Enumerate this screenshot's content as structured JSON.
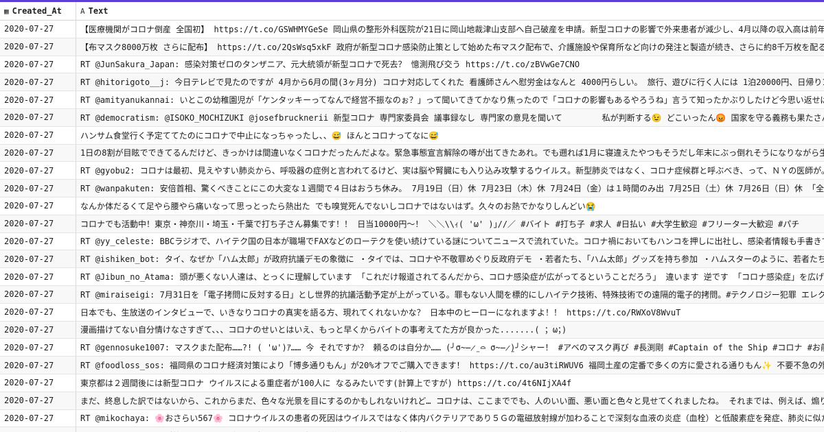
{
  "columns": {
    "date": {
      "icon": "▦",
      "label": "Created_At"
    },
    "text": {
      "icon": "A",
      "label": "Text"
    }
  },
  "rows": [
    {
      "date": "2020-07-27",
      "text": "【医療機関がコロナ倒産 全国初】 https://t.co/GSWHMYGeSe 岡山県の整形外科医院が21日に岡山地裁津山支部へ自己破産を申請。新型コロナの影響で外来患者が減少し、4月以降の収入高は前年同"
    },
    {
      "date": "2020-07-27",
      "text": "【布マスク8000万枚 さらに配布】 https://t.co/2QsWsq5xkF 政府が新型コロナ感染防止策として始めた布マスク配布で、介護施設や保育所など向けの発注と製造が続き、さらに約8千万枚を配る予"
    },
    {
      "date": "2020-07-27",
      "text": "RT @JunSakura_Japan: 感染対策ゼロのタンザニア、元大統領が新型コロナで死去？ 憶測飛び交う https://t.co/zBVwGe7CNO"
    },
    {
      "date": "2020-07-27",
      "text": "RT @hitorigoto__j: 今日テレビで見たのですが 4月から6月の間(3ヶ月分) コロナ対応してくれた 看護師さんへ慰労金はなんと 4000円らしい。 旅行、遊びに行く人には 1泊20000円、日帰り1万"
    },
    {
      "date": "2020-07-27",
      "text": "RT @amityanukannai: いとこの幼稚園児が「ケンタッキーってなんで経営不振なのぉ？」って聞いてきてかなり焦ったので「コロナの影響もあるやろうね」言うて知ったかぶりしたけど今思い返せば"
    },
    {
      "date": "2020-07-27",
      "text": "RT @democratism: @ISOKO_MOCHIZUKI @josefbrucknerii 新型コロナ 専門家委員会 議事録なし 専門家の意見を聞いて        私が判断する😉 どこいったん😡 国家を守る義務も果たさん奴は"
    },
    {
      "date": "2020-07-27",
      "text": "ハンサム食堂行く予定ててたのにコロナで中止になっちゃったし、、😅 ほんとコロナってなに😅"
    },
    {
      "date": "2020-07-27",
      "text": "1日の8割が目眩でできてるんだけど、きっかけは間違いなくコロナだったんだよな。緊急事態宣言解除の噂が出てきたあれ。でも遡れば1月に寝違えたやつもそうだし年末にぶっ倒れそうになりながら生"
    },
    {
      "date": "2020-07-27",
      "text": "RT @gyobu2: コロナは最初、見えやすい肺炎から、呼吸器の症例と言われてるけど、実は脳や腎臓にも入り込み攻撃するウイルス。新型肺炎ではなく、コロナ症候群と呼ぶべき、って、ＮＹの医師が。"
    },
    {
      "date": "2020-07-27",
      "text": "RT @wanpakuten: 安倍首相、驚くべきことにこの大変な１週間で４日はおうち休み。 7月19日（日）休 7月23日（木）休 7月24日（金）は１時間のみ出 7月25日（土）休 7月26日（日）休 「全力"
    },
    {
      "date": "2020-07-27",
      "text": "なんか体だるくて足やら腰やら痛いなって思っとったら熱出た でも嗅覚死んでないしコロナではないはず。久々のお熱でかなりしんどい😭"
    },
    {
      "date": "2020-07-27",
      "text": "コロナでも活動中！東京・神奈川・埼玉・千葉で打ち子さん募集です！！ 日当10000円～！ ＼＼\\\\ｨ( 'ω' )｣//／ #バイト #打ち子 #求人 #日払い #大学生歓迎 #フリーター大歓迎 #パチ"
    },
    {
      "date": "2020-07-27",
      "text": "RT @yy_celeste: BBCラジオで、ハイテク国の日本が職場でFAXなどのローテクを使い続けている謎についてニュースで流れていた。コロナ禍においてもハンコを押しに出社し、感染者情報も手書きで"
    },
    {
      "date": "2020-07-27",
      "text": "RT @ishiken_bot: タイ、なぜか「ハム太郎」が政府抗議デモの象徴に ・タイでは、コロナや不敬罪めぐり反政府デモ ・若者たち、「ハム太郎」グッズを持ち参加 ・ハムスターのように、若者たち"
    },
    {
      "date": "2020-07-27",
      "text": "RT @Jibun_no_Atama: 頭が悪くない人達は、とっくに理解しています 「これだけ報道されてるんだから、コロナ感染症が広がってるということだろう」 違います 逆です 「コロナ感染症」を広げた"
    },
    {
      "date": "2020-07-27",
      "text": "RT @miraiseigi: 7月31日を「電子拷問に反対する日」とし世界的抗議活動予定が上がっている。罪もない人間を標的にしハイテク技術、特殊技術での遠隔的電子的拷問。#テクノロジー犯罪 エレクト"
    },
    {
      "date": "2020-07-27",
      "text": "日本でも、生放送のインタビューで、いきなりコロナの真実を語る方、現れてくれないかな？ 日本中のヒーローになれますよ！！ https://t.co/RWXoV8WvuT"
    },
    {
      "date": "2020-07-27",
      "text": "漫画描けてない自分情けなさすぎて、、、コロナのせいとはいえ、もっと早くからバイトの事考えてた方が良かった.......( ；ω；)"
    },
    {
      "date": "2020-07-27",
      "text": "RT @gennosuke1007: マスクまた配布……?! ( 'ω')ｱ…… 今 それですか？ 頼るのは自分か…… (╯σ̴̶̷̤ ⌓ σ̴̶̷̤)╯シャー！ #アベのマスク再び #長渕剛 #Captain of the Ship #コロナ #お前が舵を取れ"
    },
    {
      "date": "2020-07-27",
      "text": "RT @foodloss_sos: 福岡県のコロナ経済対策により「博多通りもん」が20%オフでご購入できます！ https://t.co/au3tiRWUV6 福岡土産の定番で多くの方に愛される通りもん✨ 不要不急の外出"
    },
    {
      "date": "2020-07-27",
      "text": "東京都は２週間後には新型コロナ ウイルスによる重症者が100人に なるみたいです(計算上ですが) https://t.co/4t6NIjXA4f"
    },
    {
      "date": "2020-07-27",
      "text": "まだ、終息した訳ではないから、これからまだ、色々な光景を目にするのかもしれないけれど… コロナは、ここまででも、人のいい面、悪い面と色々と見せてくれましたね。 それまでは、例えば、煽り"
    },
    {
      "date": "2020-07-27",
      "text": "RT @mikochaya: 🌸おさらい567🌸 コロナウイルスの患者の死因はウイルスではなく体内バクテリアであり５Ｇの電磁放射線が加わることで深刻な血液の炎症（血栓）と低酸素症を発症、肺炎に似た"
    },
    {
      "date": "2020-07-27",
      "text": "RT @cooo55: コロナ対策もせずに、国会にも出ずに平凡な毎日を送りたいのなら、辞任すべきだ。 https://t.co/kb5VBbUa0W"
    }
  ]
}
